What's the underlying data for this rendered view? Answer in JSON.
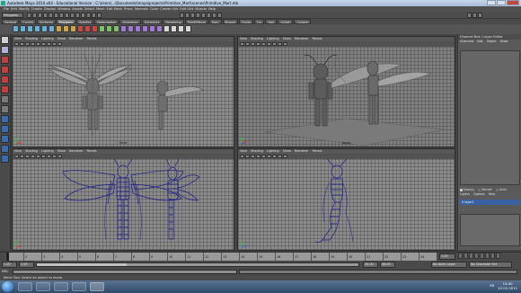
{
  "window": {
    "title": "Autodesk Maya 2010 x64 - Educational Version : C:\\Users\\...\\Documents\\maya\\projects\\Primitive_Mart\\scenes\\Primitive_Mart.mb",
    "controls": [
      "minimize",
      "maximize",
      "close"
    ]
  },
  "menubar": [
    "File",
    "Edit",
    "Modify",
    "Create",
    "Display",
    "Window",
    "Assets",
    "Select",
    "Mesh",
    "Edit Mesh",
    "Proxy",
    "Normals",
    "Color",
    "Create UVs",
    "Edit UVs",
    "Muscle",
    "Help"
  ],
  "status_line": {
    "mode": "Polygons"
  },
  "shelf": {
    "tabs": [
      "General",
      "Curves",
      "Surfaces",
      "Polygons",
      "Subdivs",
      "Deformation",
      "Animation",
      "Dynamics",
      "Rendering",
      "PaintEffects",
      "Toon",
      "Muscle",
      "Fluids",
      "Fur",
      "Hair",
      "nCloth",
      "Custom"
    ],
    "active_tab": "Polygons"
  },
  "viewports": [
    {
      "menu": [
        "View",
        "Shading",
        "Lighting",
        "Show",
        "Renderer",
        "Panels"
      ],
      "label": "front",
      "shading": "shaded"
    },
    {
      "menu": [
        "View",
        "Shading",
        "Lighting",
        "Show",
        "Renderer",
        "Panels"
      ],
      "label": "persp",
      "shading": "shaded"
    },
    {
      "menu": [
        "View",
        "Shading",
        "Lighting",
        "Show",
        "Renderer",
        "Panels"
      ],
      "label": "",
      "shading": "wireframe"
    },
    {
      "menu": [
        "View",
        "Shading",
        "Lighting",
        "Show",
        "Renderer",
        "Panels"
      ],
      "label": "",
      "shading": "wireframe"
    }
  ],
  "channel_box": {
    "header": "Channel Box / Layer Editor",
    "menu": [
      "Channels",
      "Edit",
      "Object",
      "Show"
    ]
  },
  "layer_editor": {
    "modes": [
      "Display",
      "Render",
      "Anim"
    ],
    "menu": [
      "Layers",
      "Options",
      "Help"
    ],
    "layers": [
      "V  layer1"
    ]
  },
  "timeline": {
    "ticks": [
      "1",
      "2",
      "3",
      "4",
      "5",
      "6",
      "7",
      "8",
      "9",
      "10",
      "11",
      "12",
      "13",
      "14",
      "15",
      "16",
      "17",
      "18",
      "19",
      "20",
      "21",
      "22",
      "23",
      "24"
    ],
    "current_frame": "1.00"
  },
  "range": {
    "start": "1.00",
    "playback_start": "1.00",
    "playback_end": "24.00",
    "end": "48.00",
    "anim_layer": "No Anim Layer",
    "character_set": "No Character Set"
  },
  "command_line": {
    "label": "MEL"
  },
  "help_line": {
    "text": "Move Tool: Select an object to move."
  },
  "taskbar": {
    "time": "14:40",
    "date": "22.02.2011",
    "lang": "EN"
  },
  "colors": {
    "wireframe": "#1a1a8c",
    "ui_bg": "#444444",
    "layer_highlight": "#3a62a3"
  }
}
